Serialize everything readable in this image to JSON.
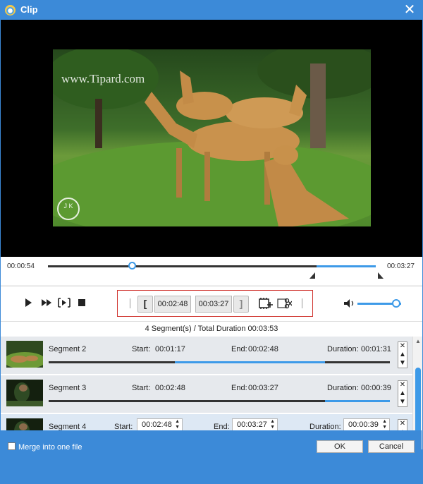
{
  "window": {
    "title": "Clip",
    "close_icon": "close-icon",
    "app_icon": "app-logo-icon"
  },
  "preview": {
    "watermark": "www.Tipard.com",
    "seal_text": "J K"
  },
  "timeline": {
    "current_time": "00:00:54",
    "total_time": "00:03:27",
    "playhead_fraction": 0.26,
    "selection_fraction": [
      0.82,
      1.0
    ]
  },
  "controls": {
    "play_icon": "play-icon",
    "fast_forward_icon": "fast-forward-icon",
    "frame_icon": "frame-step-icon",
    "stop_icon": "stop-icon",
    "set_start_label": "[",
    "start_time": "00:02:48",
    "end_time": "00:03:27",
    "set_end_label": "]",
    "new_segment_icon": "add-segment-icon",
    "split_icon": "split-scissors-icon",
    "volume_icon": "volume-icon",
    "volume_level": 0.88
  },
  "summary": {
    "text": "4 Segment(s) / Total Duration 00:03:53"
  },
  "segments": [
    {
      "name": "Segment 2",
      "start_label": "Start:",
      "start": "00:01:17",
      "end_label": "End:",
      "end": "00:02:48",
      "duration_label": "Duration:",
      "duration": "00:01:31",
      "range": [
        0.37,
        0.81
      ]
    },
    {
      "name": "Segment 3",
      "start_label": "Start:",
      "start": "00:02:48",
      "end_label": "End:",
      "end": "00:03:27",
      "duration_label": "Duration:",
      "duration": "00:00:39",
      "range": [
        0.81,
        1.0
      ]
    },
    {
      "name": "Segment 4",
      "start_label": "Start:",
      "start": "00:02:48",
      "end_label": "End:",
      "end": "00:03:27",
      "duration_label": "Duration:",
      "duration": "00:00:39",
      "range": [
        0.81,
        1.0
      ]
    }
  ],
  "footer": {
    "merge_label": "Merge into one file",
    "merge_checked": false,
    "ok_label": "OK",
    "cancel_label": "Cancel"
  },
  "colors": {
    "accent": "#3d9ae8",
    "titlebar": "#3c8ad8",
    "highlight": "#d0332d"
  }
}
